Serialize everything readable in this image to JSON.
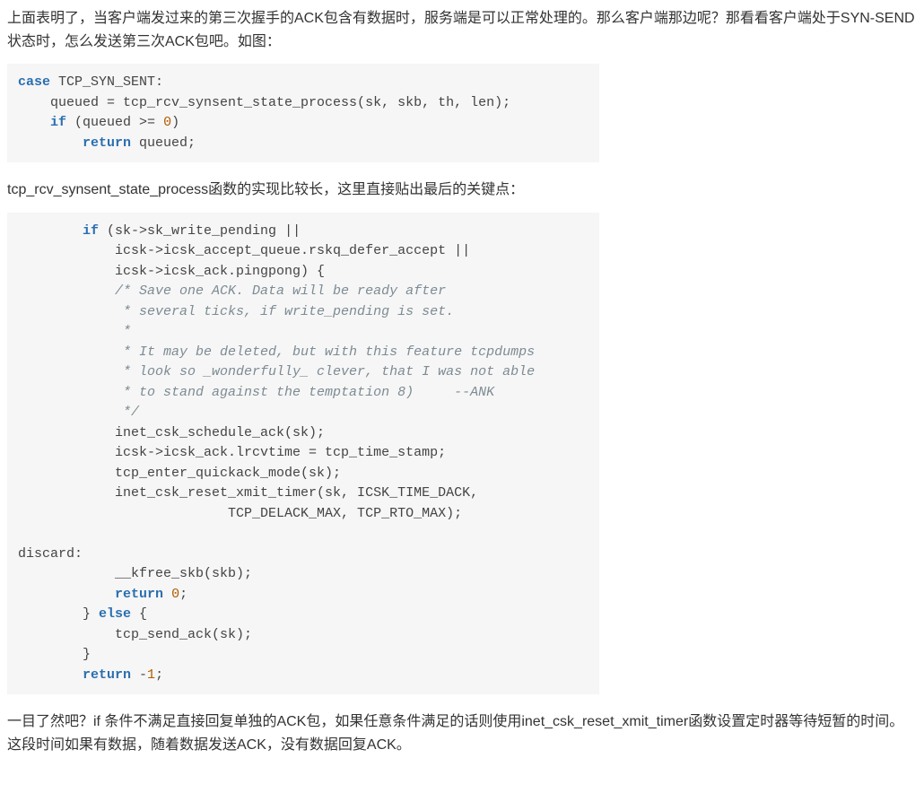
{
  "para1": "上面表明了，当客户端发过来的第三次握手的ACK包含有数据时，服务端是可以正常处理的。那么客户端那边呢？那看看客户端处于SYN-SEND状态时，怎么发送第三次ACK包吧。如图：",
  "code1": {
    "l1a": "case",
    "l1b": " TCP_SYN_SENT:",
    "l2a": "    queued = tcp_rcv_synsent_state_process(sk, skb, th, len);",
    "l3a": "    ",
    "l3b": "if",
    "l3c": " (queued >= ",
    "l3d": "0",
    "l3e": ")",
    "l4a": "        ",
    "l4b": "return",
    "l4c": " queued;"
  },
  "para2": "tcp_rcv_synsent_state_process函数的实现比较长，这里直接贴出最后的关键点：",
  "code2": {
    "l01a": "        ",
    "l01b": "if",
    "l01c": " (sk->sk_write_pending ||",
    "l02": "            icsk->icsk_accept_queue.rskq_defer_accept ||",
    "l03": "            icsk->icsk_ack.pingpong) {",
    "l04": "            /* Save one ACK. Data will be ready after",
    "l05": "             * several ticks, if write_pending is set.",
    "l06": "             *",
    "l07": "             * It may be deleted, but with this feature tcpdumps",
    "l08": "             * look so _wonderfully_ clever, that I was not able",
    "l09": "             * to stand against the temptation 8)     --ANK",
    "l10": "             */",
    "l11": "            inet_csk_schedule_ack(sk);",
    "l12": "            icsk->icsk_ack.lrcvtime = tcp_time_stamp;",
    "l13": "            tcp_enter_quickack_mode(sk);",
    "l14": "            inet_csk_reset_xmit_timer(sk, ICSK_TIME_DACK,",
    "l15": "                          TCP_DELACK_MAX, TCP_RTO_MAX);",
    "l16": "",
    "l17": "discard:",
    "l18": "            __kfree_skb(skb);",
    "l19a": "            ",
    "l19b": "return",
    "l19c": " ",
    "l19d": "0",
    "l19e": ";",
    "l20a": "        } ",
    "l20b": "else",
    "l20c": " {",
    "l21": "            tcp_send_ack(sk);",
    "l22": "        }",
    "l23a": "        ",
    "l23b": "return",
    "l23c": " -",
    "l23d": "1",
    "l23e": ";"
  },
  "para3": "一目了然吧？if 条件不满足直接回复单独的ACK包，如果任意条件满足的话则使用inet_csk_reset_xmit_timer函数设置定时器等待短暂的时间。这段时间如果有数据，随着数据发送ACK，没有数据回复ACK。"
}
